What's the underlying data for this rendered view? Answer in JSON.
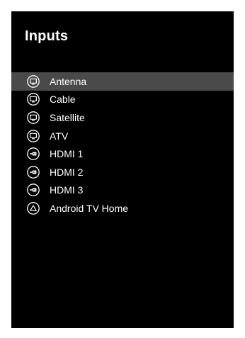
{
  "panel": {
    "title": "Inputs",
    "background": "#000000",
    "selected_color": "#4a4a4a"
  },
  "inputs": [
    {
      "label": "Antenna",
      "icon": "tv-icon",
      "selected": true
    },
    {
      "label": "Cable",
      "icon": "tv-icon",
      "selected": false
    },
    {
      "label": "Satellite",
      "icon": "tv-icon",
      "selected": false
    },
    {
      "label": "ATV",
      "icon": "tv-icon",
      "selected": false
    },
    {
      "label": "HDMI 1",
      "icon": "hdmi-icon",
      "selected": false
    },
    {
      "label": "HDMI 2",
      "icon": "hdmi-icon",
      "selected": false
    },
    {
      "label": "HDMI 3",
      "icon": "hdmi-icon",
      "selected": false
    },
    {
      "label": "Android TV Home",
      "icon": "home-triangle-icon",
      "selected": false
    }
  ]
}
